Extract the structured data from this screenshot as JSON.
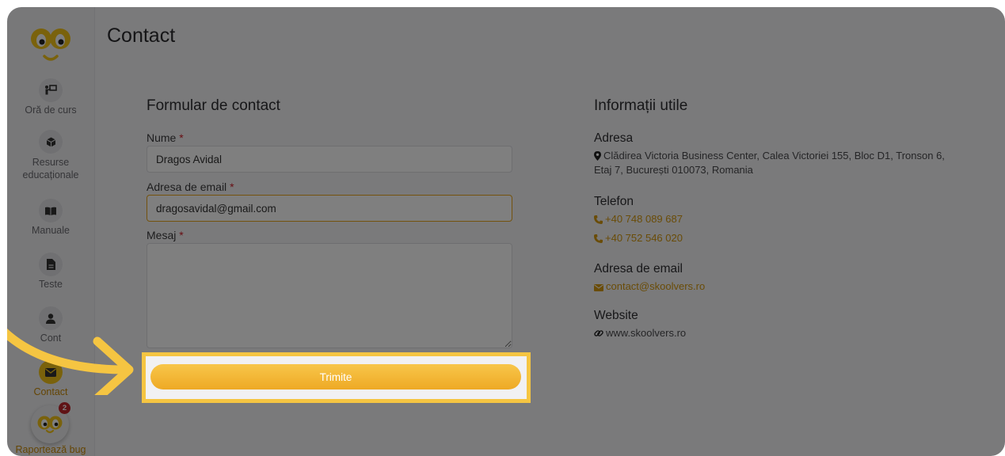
{
  "page": {
    "title": "Contact"
  },
  "sidebar": {
    "items": [
      {
        "label": "Oră de curs",
        "icon": "teacher-board-icon"
      },
      {
        "label": "Resurse educaționale",
        "icon": "cube-icon"
      },
      {
        "label": "Manuale",
        "icon": "book-icon"
      },
      {
        "label": "Teste",
        "icon": "document-icon"
      },
      {
        "label": "Cont",
        "icon": "user-icon"
      },
      {
        "label": "Contact",
        "icon": "envelope-icon",
        "active": true
      }
    ],
    "bug_report": {
      "label": "Raportează bug",
      "badge": "2"
    }
  },
  "form": {
    "title": "Formular de contact",
    "name_label": "Nume",
    "name_value": "Dragos Avidal",
    "email_label": "Adresa de email",
    "email_value": "dragosavidal@gmail.com",
    "message_label": "Mesaj",
    "message_value": "",
    "required_mark": "*",
    "submit_label": "Trimite"
  },
  "info": {
    "title": "Informații utile",
    "address_heading": "Adresa",
    "address_line1": "Clădirea Victoria Business Center, Calea Victoriei 155, Bloc D1, Tronson 6,",
    "address_line2": "Etaj 7, București 010073, Romania",
    "phone_heading": "Telefon",
    "phones": [
      "+40 748 089 687",
      "+40 752 546 020"
    ],
    "email_heading": "Adresa de email",
    "email": "contact@skoolvers.ro",
    "website_heading": "Website",
    "website": "www.skoolvers.ro"
  },
  "colors": {
    "accent": "#f5c542",
    "link": "#d4980f",
    "required": "#d0202a",
    "badge": "#c0262d"
  }
}
